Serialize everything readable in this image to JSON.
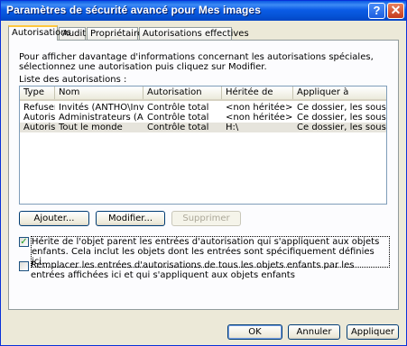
{
  "window": {
    "title": "Paramètres de sécurité avancé pour Mes images",
    "help": "?",
    "close": "✕"
  },
  "tabs": [
    {
      "label": "Autorisations"
    },
    {
      "label": "Audit"
    },
    {
      "label": "Propriétaire"
    },
    {
      "label": "Autorisations effectives"
    }
  ],
  "intro_text": "Pour afficher davantage d'informations concernant les autorisations spéciales, sélectionnez une autorisation puis cliquez sur Modifier.",
  "list_label": "Liste des autorisations :",
  "columns": [
    "Type",
    "Nom",
    "Autorisation",
    "Héritée de",
    "Appliquer à"
  ],
  "rows": [
    {
      "type": "Refuser",
      "name": "Invités (ANTHO\\Invit...",
      "perm": "Contrôle total",
      "inherited": "<non héritée>",
      "apply": "Ce dossier, les sous-d..."
    },
    {
      "type": "Autoriser",
      "name": "Administrateurs (ANT...",
      "perm": "Contrôle total",
      "inherited": "<non héritée>",
      "apply": "Ce dossier, les sous-d..."
    },
    {
      "type": "Autoriser",
      "name": "Tout le monde",
      "perm": "Contrôle total",
      "inherited": "H:\\",
      "apply": "Ce dossier, les sous-d..."
    }
  ],
  "buttons": {
    "add": "Ajouter...",
    "modify": "Modifier...",
    "delete": "Supprimer",
    "ok": "OK",
    "cancel": "Annuler",
    "apply": "Appliquer"
  },
  "checks": [
    {
      "label": "Hérite de l'objet parent les entrées d'autorisation qui s'appliquent aux objets enfants. Cela inclut les objets dont les entrées sont spécifiquement définies ici.",
      "checked": true,
      "mark": "✓"
    },
    {
      "label": "Remplacer les entrées d'autorisations de tous les objets enfants par les entrées affichées ici et qui s'appliquent aux objets enfants",
      "checked": false,
      "mark": ""
    }
  ]
}
